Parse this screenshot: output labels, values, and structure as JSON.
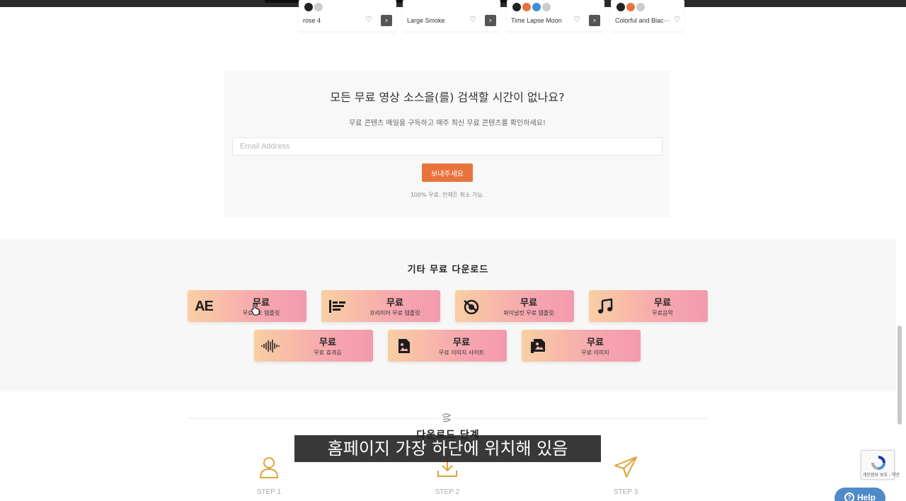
{
  "cards": [
    {
      "title": "rose 4",
      "badges": [
        "#222222",
        "#cccccc"
      ]
    },
    {
      "title": "Large Smoke",
      "badges": []
    },
    {
      "title": "Time Lapse Moon",
      "badges": [
        "#222222",
        "#e8733d",
        "#3b8fd6",
        "#cccccc"
      ]
    },
    {
      "title": "Colorful and Blac···",
      "badges": [
        "#222222",
        "#e8733d",
        "#cccccc"
      ]
    }
  ],
  "newsletter": {
    "title": "모든 무료 영상 소스을(를) 검색할 시간이 없나요?",
    "subtitle": "무료 콘텐츠 메일을 구독하고 매주 최신 무료 콘텐츠를 확인하세요!",
    "email_placeholder": "Email Address",
    "submit_label": "보내주세요",
    "note": "100% 무료. 언제든 취소 가능."
  },
  "other_downloads": {
    "title": "기타 무료 다운로드",
    "tiles": [
      {
        "main": "무료",
        "sub": "무료 AE 템플릿",
        "icon": "after-effects-icon",
        "icon_text": "AE"
      },
      {
        "main": "무료",
        "sub": "프리미어 무료 템플릿",
        "icon": "premiere-timeline-icon"
      },
      {
        "main": "무료",
        "sub": "파이널컷 무료 템플릿",
        "icon": "final-cut-icon"
      },
      {
        "main": "무료",
        "sub": "무료음악",
        "icon": "music-note-icon"
      },
      {
        "main": "무료",
        "sub": "무료 효과음",
        "icon": "sound-wave-icon"
      },
      {
        "main": "무료",
        "sub": "무료 이미지 사이트",
        "icon": "image-file-icon"
      },
      {
        "main": "무료",
        "sub": "무료 이미지",
        "icon": "image-stack-icon"
      }
    ]
  },
  "steps": {
    "title": "다운로드 단계",
    "items": [
      {
        "label": "STEP 1",
        "icon": "user-icon"
      },
      {
        "label": "STEP 2",
        "icon": "download-icon"
      },
      {
        "label": "STEP 3",
        "icon": "paper-plane-icon"
      }
    ]
  },
  "caption": "홈페이지 가장 하단에 위치해 있음",
  "recaptcha": {
    "label": "개인정보 보호 - 약관"
  },
  "help": {
    "label": "Help"
  },
  "colors": {
    "accent": "#e9733d",
    "tile_gradient_start": "#f9cfa3",
    "tile_gradient_end": "#f39aae",
    "help": "#4f8bc9",
    "step_icon": "#e0a33a"
  }
}
